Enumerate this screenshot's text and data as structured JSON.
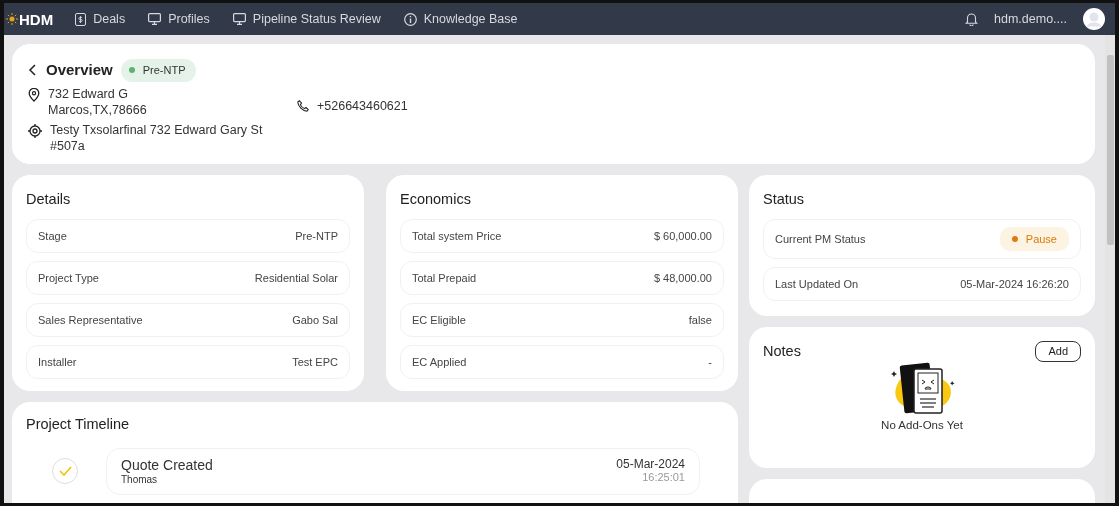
{
  "navbar": {
    "logo": "HDM",
    "items": [
      {
        "label": "Deals",
        "kind": "dollar"
      },
      {
        "label": "Profiles",
        "kind": "monitor"
      },
      {
        "label": "Pipeline Status Review",
        "kind": "monitor"
      },
      {
        "label": "Knowledge Base",
        "kind": "info"
      }
    ],
    "user": "hdm.demo...."
  },
  "overview": {
    "title": "Overview",
    "stage_badge": "Pre-NTP",
    "address": [
      "732 Edward G",
      "Marcos,TX,78666"
    ],
    "site": [
      "Testy Txsolarfinal 732 Edward Gary St",
      "#507a"
    ],
    "phone": "+526643460621"
  },
  "details": {
    "title": "Details",
    "rows": [
      {
        "label": "Stage",
        "value": "Pre-NTP"
      },
      {
        "label": "Project Type",
        "value": "Residential Solar"
      },
      {
        "label": "Sales Representative",
        "value": "Gabo Sal"
      },
      {
        "label": "Installer",
        "value": "Test EPC"
      }
    ]
  },
  "economics": {
    "title": "Economics",
    "rows": [
      {
        "label": "Total system Price",
        "value": "$ 60,000.00"
      },
      {
        "label": "Total Prepaid",
        "value": "$ 48,000.00"
      },
      {
        "label": "EC Eligible",
        "value": "false"
      },
      {
        "label": "EC Applied",
        "value": "-"
      }
    ]
  },
  "status": {
    "title": "Status",
    "rows": [
      {
        "label": "Current PM Status",
        "value": "Pause",
        "kind": "badge"
      },
      {
        "label": "Last Updated On",
        "value": "05-Mar-2024 16:26:20",
        "kind": "text"
      }
    ]
  },
  "notes": {
    "title": "Notes",
    "add_button": "Add",
    "empty_text": "No Add-Ons Yet"
  },
  "timeline": {
    "title": "Project Timeline",
    "events": [
      {
        "title": "Quote Created",
        "by": "Thomas",
        "date": "05-Mar-2024",
        "time": "16:25:01",
        "done": true
      }
    ]
  }
}
